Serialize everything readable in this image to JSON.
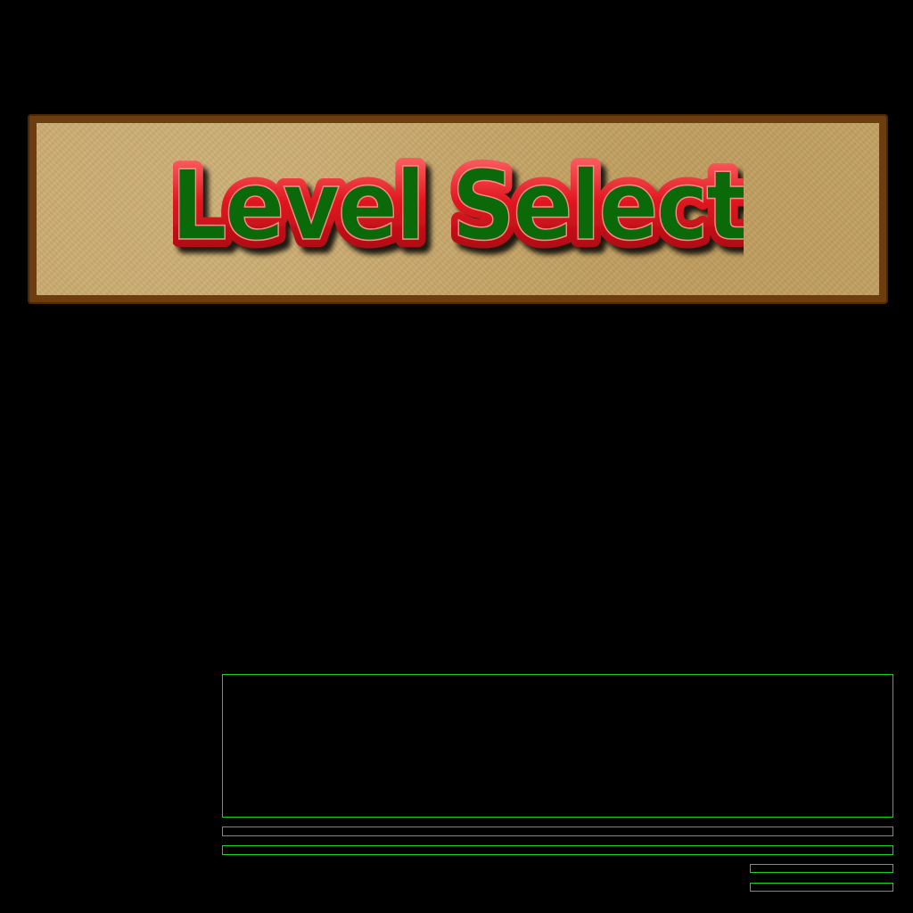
{
  "title": {
    "text": "Level Select",
    "fill_color": "#0a6a0a",
    "outline_color": "#e01820"
  },
  "banner": {
    "frame_color": "#6b3d0f",
    "paper_color": "#c9a868"
  },
  "panels": {
    "border_color": "#19d219"
  }
}
